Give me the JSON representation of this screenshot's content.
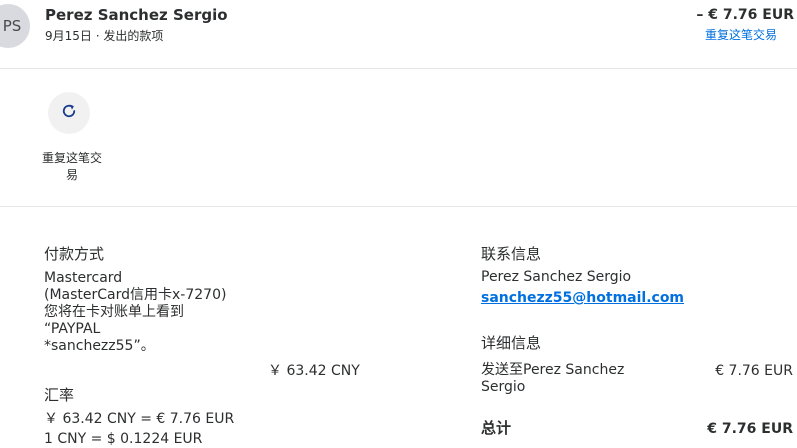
{
  "header": {
    "avatar_initials": "PS",
    "name": "Perez Sanchez Sergio",
    "subtitle": "9月15日 · 发出的款项",
    "amount": "– € 7.76 EUR",
    "repeat_link": "重复这笔交易"
  },
  "actions": {
    "repeat_icon": "refresh-icon",
    "repeat_label": "重复这笔交易"
  },
  "payment": {
    "heading": "付款方式",
    "method_lines": [
      "Mastercard",
      "(MasterCard信用卡x-7270)",
      "您将在卡对账单上看到",
      "“PAYPAL",
      "*sanchezz55”。"
    ],
    "amount": "￥ 63.42 CNY"
  },
  "exchange": {
    "heading": "汇率",
    "line1": "￥ 63.42 CNY = € 7.76 EUR",
    "line2": "1 CNY = $ 0.1224 EUR"
  },
  "contact": {
    "heading": "联系信息",
    "name": "Perez Sanchez Sergio",
    "email": "sanchezz55@hotmail.com"
  },
  "details": {
    "heading": "详细信息",
    "sent_to_line1": "发送至Perez Sanchez",
    "sent_to_line2": "Sergio",
    "sent_amount": "€ 7.76 EUR",
    "total_label": "总计",
    "total_amount": "€ 7.76 EUR"
  },
  "colors": {
    "link": "#0070e0",
    "avatar_bg": "#d9d9e0",
    "text": "#2c2e2f"
  }
}
